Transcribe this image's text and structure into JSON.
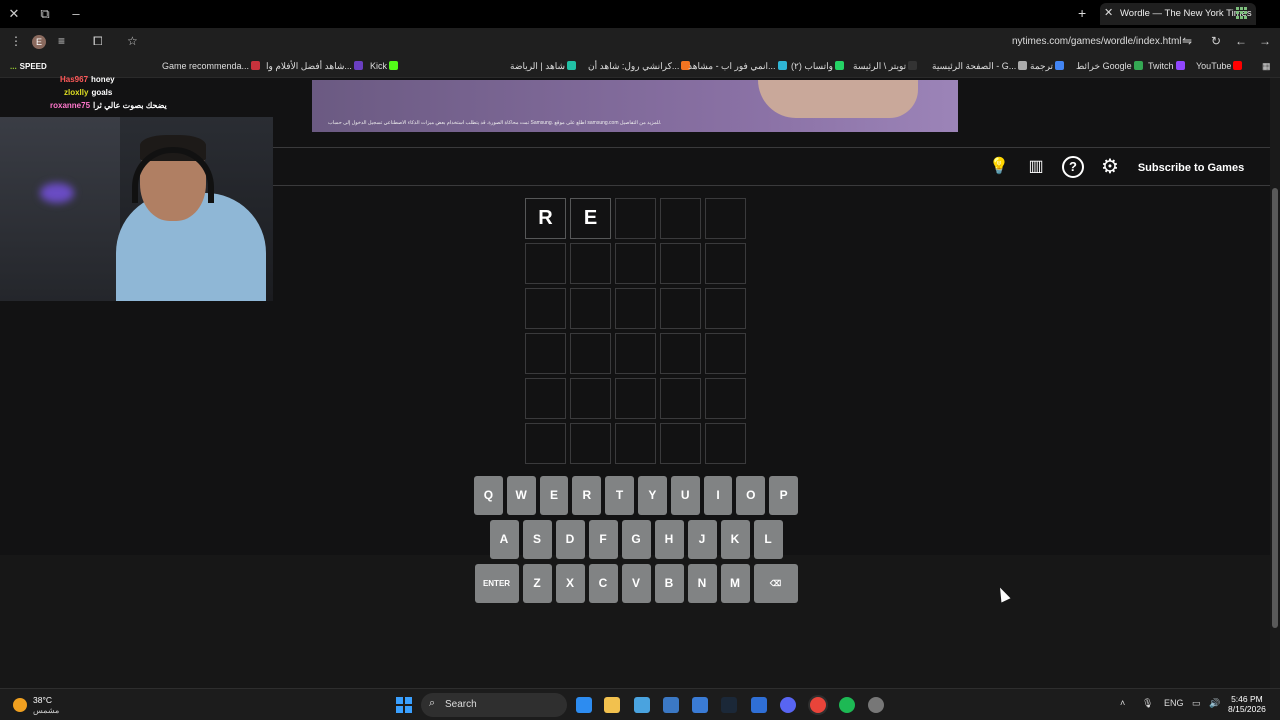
{
  "browser": {
    "tab_title": "Wordle — The New York Times",
    "url": "nytimes.com/games/wordle/index.html",
    "profile_initial": "E",
    "bookmarks": [
      {
        "label": "Game recommenda...",
        "color": "#c8323c"
      },
      {
        "label": "شاهد أفضل الأفلام وا...",
        "color": "#6a3fc1"
      },
      {
        "label": "Kick",
        "color": "#53fc18"
      },
      {
        "label": "شاهد | الرياضة",
        "color": "#21c0a5"
      },
      {
        "label": "كرانشي رول: شاهد أن...",
        "color": "#f47521"
      },
      {
        "label": "انمي فور اب - مشاهد...",
        "color": "#2fb5d5"
      },
      {
        "label": "(٢) واتساب",
        "color": "#25d366"
      },
      {
        "label": "تويتر \\ الرئيسة",
        "color": "#333333"
      },
      {
        "label": "الصفحة الرئيسية - G...",
        "color": "#aaaaaa"
      },
      {
        "label": "ترجمة",
        "color": "#4285f4"
      },
      {
        "label": "خرائط Google",
        "color": "#34a853"
      },
      {
        "label": "Twitch",
        "color": "#9146ff"
      },
      {
        "label": "YouTube",
        "color": "#ff0000"
      }
    ]
  },
  "ad": {
    "fine_print": "تمت محاكاة الصورة. قد يتطلب استخدام بعض ميزات الذكاء الاصطناعي تسجيل الدخول إلى حساب Samsung. اطلع على موقع samsung.com للمزيد من التفاصيل."
  },
  "game": {
    "subscribe_label": "Subscribe to Games",
    "board": [
      [
        "R",
        "E",
        "",
        "",
        ""
      ],
      [
        "",
        "",
        "",
        "",
        ""
      ],
      [
        "",
        "",
        "",
        "",
        ""
      ],
      [
        "",
        "",
        "",
        "",
        ""
      ],
      [
        "",
        "",
        "",
        "",
        ""
      ],
      [
        "",
        "",
        "",
        "",
        ""
      ]
    ],
    "keyboard": [
      [
        "Q",
        "W",
        "E",
        "R",
        "T",
        "Y",
        "U",
        "I",
        "O",
        "P"
      ],
      [
        "A",
        "S",
        "D",
        "F",
        "G",
        "H",
        "J",
        "K",
        "L"
      ],
      [
        "ENTER",
        "Z",
        "X",
        "C",
        "V",
        "B",
        "N",
        "M",
        "⌫"
      ]
    ]
  },
  "stream_chat": [
    {
      "user": "...",
      "message": "SPEED",
      "color": "#9acd32"
    },
    {
      "user": "Has967",
      "message": "honey",
      "color": "#ff5a5a"
    },
    {
      "user": "zloxlly",
      "message": "goals",
      "color": "#dddd22"
    },
    {
      "user": "roxanne75",
      "message": "يضحك بصوت عالي ثرا",
      "color": "#ff77cc"
    }
  ],
  "taskbar": {
    "temperature": "38°C",
    "condition": "مشمس",
    "search_label": "Search",
    "language": "ENG",
    "time": "5:46 PM",
    "date": "8/15/2026"
  }
}
